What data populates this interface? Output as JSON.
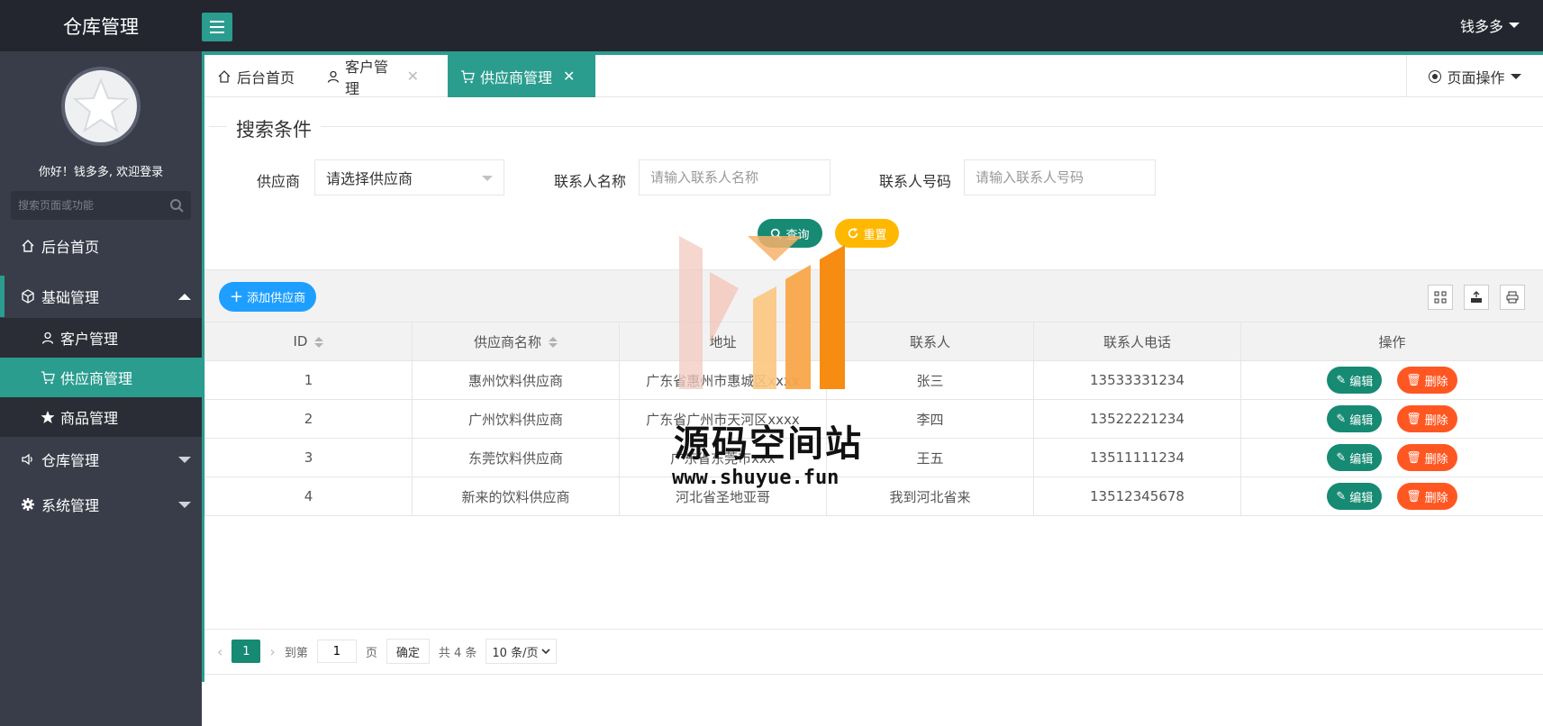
{
  "header": {
    "app_title": "仓库管理",
    "user_name": "钱多多"
  },
  "sidebar": {
    "welcome": "你好！钱多多, 欢迎登录",
    "search_placeholder": "搜索页面或功能",
    "items": [
      {
        "label": "后台首页",
        "icon": "home-icon"
      },
      {
        "label": "基础管理",
        "icon": "cube-icon",
        "expanded": true,
        "children": [
          {
            "label": "客户管理",
            "icon": "user-icon"
          },
          {
            "label": "供应商管理",
            "icon": "cart-icon",
            "active": true
          },
          {
            "label": "商品管理",
            "icon": "star-icon"
          }
        ]
      },
      {
        "label": "仓库管理",
        "icon": "speaker-icon"
      },
      {
        "label": "系统管理",
        "icon": "gear-icon"
      }
    ]
  },
  "tabs": [
    {
      "label": "后台首页",
      "icon": "home-icon"
    },
    {
      "label": "客户管理",
      "icon": "user-icon",
      "closable": true
    },
    {
      "label": "供应商管理",
      "icon": "cart-icon",
      "closable": true,
      "active": true
    }
  ],
  "page_ops": {
    "label": "页面操作"
  },
  "search": {
    "legend": "搜索条件",
    "supplier_label": "供应商",
    "supplier_value": "请选择供应商",
    "contact_name_label": "联系人名称",
    "contact_name_placeholder": "请输入联系人名称",
    "contact_phone_label": "联系人号码",
    "contact_phone_placeholder": "请输入联系人号码",
    "query_label": "查询",
    "reset_label": "重置"
  },
  "toolbar": {
    "add_label": "添加供应商"
  },
  "table": {
    "columns": [
      "ID",
      "供应商名称",
      "地址",
      "联系人",
      "联系人电话",
      "操作"
    ],
    "edit_label": "编辑",
    "delete_label": "删除",
    "rows": [
      {
        "id": "1",
        "name": "惠州饮料供应商",
        "address": "广东省惠州市惠城区xxxx",
        "contact": "张三",
        "phone": "13533331234"
      },
      {
        "id": "2",
        "name": "广州饮料供应商",
        "address": "广东省广州市天河区xxxx",
        "contact": "李四",
        "phone": "13522221234"
      },
      {
        "id": "3",
        "name": "东莞饮料供应商",
        "address": "广东省东莞市xxx",
        "contact": "王五",
        "phone": "13511111234"
      },
      {
        "id": "4",
        "name": "新来的饮料供应商",
        "address": "河北省圣地亚哥",
        "contact": "我到河北省来",
        "phone": "13512345678"
      }
    ]
  },
  "pagination": {
    "current_page": "1",
    "goto_prefix": "到第",
    "goto_value": "1",
    "goto_suffix": "页",
    "confirm_label": "确定",
    "total_text": "共 4 条",
    "page_size": "10 条/页"
  },
  "watermark": {
    "title": "源码空间站",
    "url": "www.shuyue.fun"
  },
  "colors": {
    "accent": "#2a9d8f",
    "sidebar": "#393d49",
    "header": "#23262e",
    "blue": "#1e9fff",
    "orange": "#ffb800",
    "danger": "#ff5722"
  }
}
